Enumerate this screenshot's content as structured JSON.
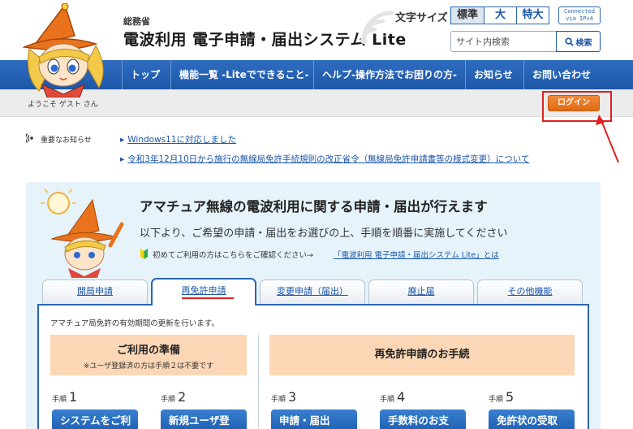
{
  "header": {
    "ministry": "総務省",
    "title": "電波利用 電子申請・届出システム Lite",
    "font_size_label": "文字サイズ",
    "font_sizes": [
      "標準",
      "大",
      "特大"
    ],
    "ipv4_badge_line1": "Connected",
    "ipv4_badge_line2": "via IPv4",
    "search_placeholder": "サイト内検索",
    "search_button": "検索"
  },
  "nav": {
    "items": [
      "トップ",
      "機能一覧 -Liteでできること-",
      "ヘルプ-操作方法でお困りの方-",
      "お知らせ",
      "お問い合わせ"
    ]
  },
  "welcome": {
    "text": "ようこそ ゲスト さん",
    "login_button": "ログイン"
  },
  "notices": {
    "label": "重要なお知らせ",
    "items": [
      "Windows11に対応しました",
      "令和3年12月10日から施行の無線局免許手続規則の改正省令（無線局免許申請書等の様式変更）について"
    ]
  },
  "panel": {
    "heading": "アマチュア無線の電波利用に関する申請・届出が行えます",
    "subheading": "以下より、ご希望の申請・届出をお選びの上、手順を順番に実施してください",
    "note": "初めてご利用の方はこちらをご確認ください→",
    "link": "「電波利用 電子申請・届出システム Lite」とは",
    "tabs": [
      "開局申請",
      "再免許申請",
      "変更申請（届出）",
      "廃止届",
      "その他機能"
    ],
    "active_tab": "再免許申請",
    "description": "アマチュア局免許の有効期間の更新を行います。",
    "prep_title": "ご利用の準備",
    "prep_note": "※ユーザ登録済の方は手順２は不要です",
    "procedure_title": "再免許申請のお手続",
    "step_prefix": "手順",
    "steps": [
      {
        "num": "1",
        "label": "システムをご利"
      },
      {
        "num": "2",
        "label": "新規ユーザ登"
      },
      {
        "num": "3",
        "label": "申請・届出"
      },
      {
        "num": "4",
        "label": "手数料のお支"
      },
      {
        "num": "5",
        "label": "免許状の受取"
      }
    ]
  },
  "colors": {
    "nav_blue": "#1d57a8",
    "login_orange": "#e26a12",
    "highlight_red": "#e02020",
    "panel_bg": "#e6f3fb",
    "step_header_bg": "#fcd7b6"
  }
}
